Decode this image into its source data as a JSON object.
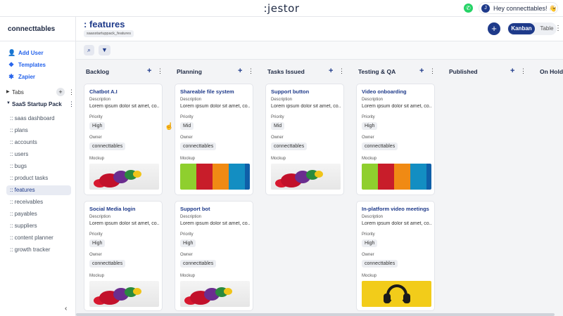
{
  "topbar": {
    "logo": ":jestor",
    "greeting": "Hey connecttables! 👋",
    "avatar_initial": "J"
  },
  "sidebar": {
    "workspace": "connecttables",
    "links": [
      {
        "name": "add-user",
        "label": "Add User",
        "icon": "👤",
        "icon_name": "add-user-icon"
      },
      {
        "name": "templates",
        "label": "Templates",
        "icon": "❖",
        "icon_name": "templates-icon"
      },
      {
        "name": "zapier",
        "label": "Zapier",
        "icon": "✱",
        "icon_name": "zapier-icon"
      }
    ],
    "tabs_label": "Tabs",
    "pack_label": "SaaS Startup Pack",
    "nav": [
      ":: saas dashboard",
      ":: plans",
      ":: accounts",
      ":: users",
      ":: bugs",
      ":: product tasks",
      ":: features",
      ":: receivables",
      ":: payables",
      ":: suppliers",
      ":: content planner",
      ":: growth tracker"
    ],
    "active_nav": ":: features"
  },
  "header": {
    "title": ": features",
    "slug": "saasstartuppack_features",
    "view_kanban": "Kanban",
    "view_table": "Table"
  },
  "colors": {
    "primary": "#1e3a8a",
    "link": "#2563eb",
    "whatsapp": "#25d366"
  },
  "board": {
    "field_labels": {
      "description": "Description",
      "priority": "Priority",
      "owner": "Owner",
      "mockup": "Mockup"
    },
    "columns": [
      {
        "title": "Backlog",
        "cards": [
          {
            "title": "Chatbot A.I",
            "description": "Lorem ipsum dolor sit amet, co...",
            "priority": "High",
            "owner": "connecttables",
            "mockup": "toys"
          },
          {
            "title": "Social Media login",
            "description": "Lorem ipsum dolor sit amet, co...",
            "priority": "High",
            "owner": "connecttables",
            "mockup": "toys"
          }
        ]
      },
      {
        "title": "Planning",
        "cards": [
          {
            "title": "Shareable file system",
            "description": "Lorem ipsum dolor sit amet, co...",
            "priority": "Mid",
            "owner": "connecttables",
            "mockup": "doors"
          },
          {
            "title": "Support bot",
            "description": "Lorem ipsum dolor sit amet, co...",
            "priority": "High",
            "owner": "connecttables",
            "mockup": "toys"
          }
        ]
      },
      {
        "title": "Tasks Issued",
        "cards": [
          {
            "title": "Support button",
            "description": "Lorem ipsum dolor sit amet, co...",
            "priority": "Mid",
            "owner": "connecttables",
            "mockup": "toys"
          }
        ]
      },
      {
        "title": "Testing & QA",
        "cards": [
          {
            "title": "Video onboarding",
            "description": "Lorem ipsum dolor sit amet, co...",
            "priority": "High",
            "owner": "connecttables",
            "mockup": "doors"
          },
          {
            "title": "In-platform video meetings",
            "description": "Lorem ipsum dolor sit amet, co...",
            "priority": "High",
            "owner": "connecttables",
            "mockup": "headphones"
          }
        ]
      },
      {
        "title": "Published",
        "cards": []
      },
      {
        "title": "On Hold",
        "cards": []
      }
    ]
  }
}
